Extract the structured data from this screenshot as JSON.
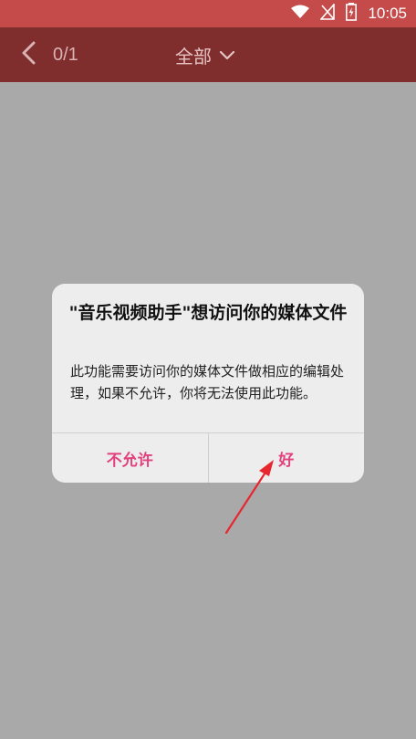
{
  "status_bar": {
    "time": "10:05",
    "icons": [
      "wifi-icon",
      "signal-off-icon",
      "battery-charging-icon"
    ]
  },
  "header": {
    "back_icon": "chevron-left-icon",
    "page_counter": "0/1",
    "filter_label": "全部",
    "filter_icon": "chevron-down-icon"
  },
  "dialog": {
    "title": "\"音乐视频助手\"想访问你的媒体文件",
    "message": "此功能需要访问你的媒体文件做相应的编辑处理，如果不允许，你将无法使用此功能。",
    "deny_label": "不允许",
    "allow_label": "好"
  },
  "annotation": {
    "arrow_icon": "red-arrow-icon"
  },
  "colors": {
    "status_bar": "#c54a4a",
    "app_bar": "#7f2d2d",
    "background_overlay": "#a9a9a9",
    "dialog_background": "#ededed",
    "button_text": "#e2417e",
    "annotation_arrow": "#e8262f"
  }
}
